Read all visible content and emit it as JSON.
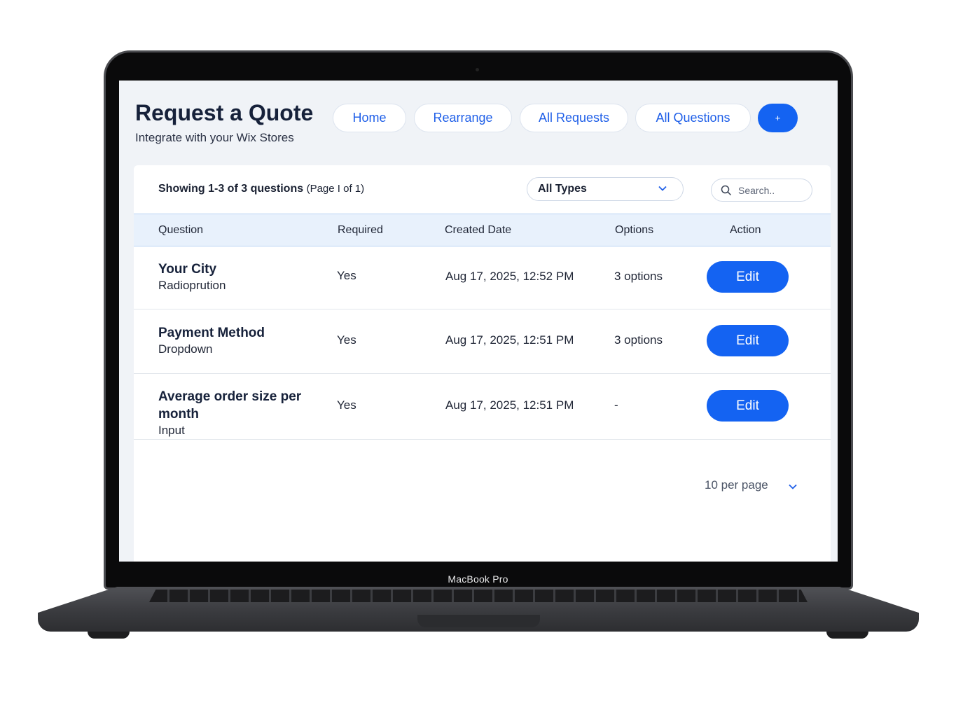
{
  "header": {
    "title": "Request a Quote",
    "subtitle": "Integrate with your Wix Stores"
  },
  "nav": {
    "home": "Home",
    "rearrange": "Rearrange",
    "all_requests": "All Requests",
    "all_questions": "All Questions",
    "add_icon": "+"
  },
  "toolbar": {
    "showing": "Showing 1-3 of 3 questions",
    "page_info": "(Page I of 1)",
    "type_filter": "All Types",
    "search_placeholder": "Search.."
  },
  "table": {
    "columns": [
      "Question",
      "Required",
      "Created Date",
      "Options",
      "Action"
    ],
    "rows": [
      {
        "title": "Your City",
        "type": "Radioprution",
        "required": "Yes",
        "created": "Aug 17, 2025, 12:52 PM",
        "options": "3 options",
        "action": "Edit"
      },
      {
        "title": "Payment Method",
        "type": "Dropdown",
        "required": "Yes",
        "created": "Aug 17, 2025, 12:51 PM",
        "options": "3 options",
        "action": "Edit"
      },
      {
        "title": "Average order size per month",
        "type": "Input",
        "required": "Yes",
        "created": "Aug 17, 2025, 12:51 PM",
        "options": "-",
        "action": "Edit"
      }
    ]
  },
  "pagination": {
    "per_page": "10 per page"
  },
  "device": {
    "label": "MacBook Pro"
  },
  "colors": {
    "accent": "#1463f2",
    "header_bg": "#e8f1fc",
    "screen_bg": "#f0f3f7"
  }
}
